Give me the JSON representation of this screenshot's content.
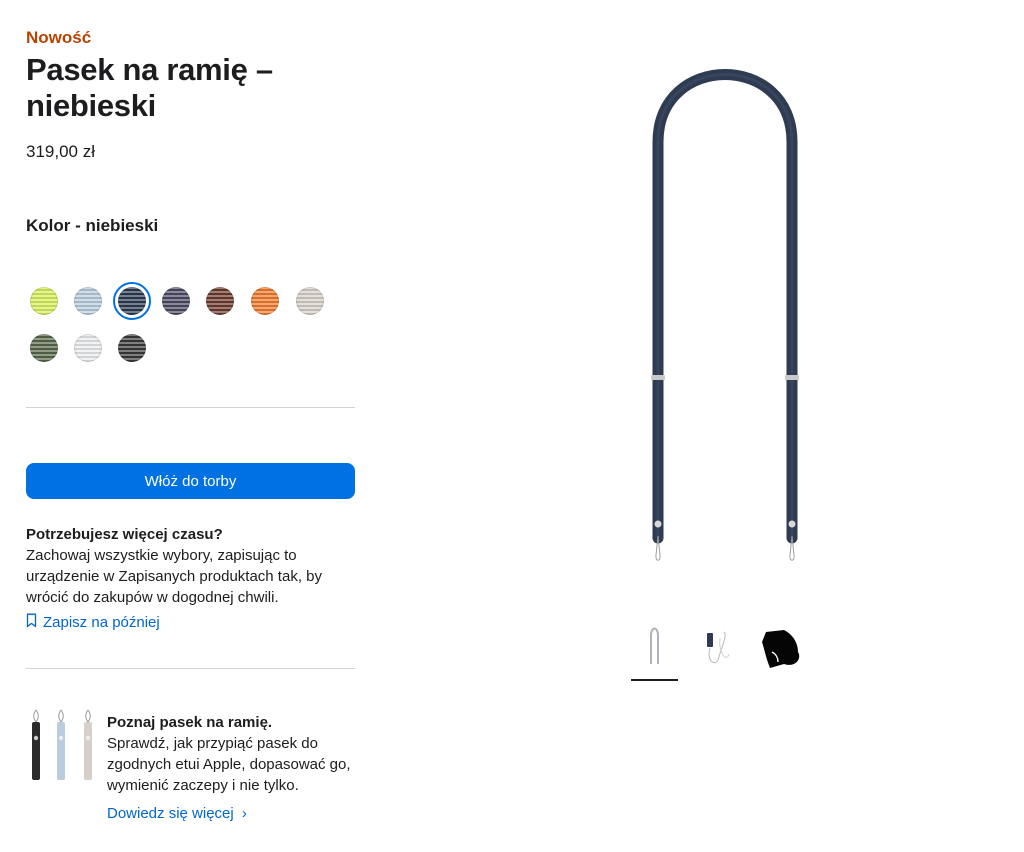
{
  "product": {
    "badge": "Nowość",
    "title": "Pasek na ramię – niebieski",
    "price": "319,00 zł",
    "color_label": "Kolor - niebieski"
  },
  "swatches": [
    {
      "name": "lime",
      "color": "#d8f05a",
      "selected": false
    },
    {
      "name": "light-blue",
      "color": "#b9cddf",
      "selected": false
    },
    {
      "name": "blue",
      "color": "#2c3a52",
      "selected": true
    },
    {
      "name": "purple",
      "color": "#4b4a62",
      "selected": false
    },
    {
      "name": "brown",
      "color": "#6b3b2d",
      "selected": false
    },
    {
      "name": "orange",
      "color": "#f07a2c",
      "selected": false
    },
    {
      "name": "stone",
      "color": "#d7d0c8",
      "selected": false
    },
    {
      "name": "green",
      "color": "#56684a",
      "selected": false
    },
    {
      "name": "white",
      "color": "#e9ebee",
      "selected": false
    },
    {
      "name": "black",
      "color": "#3a3a3c",
      "selected": false
    }
  ],
  "actions": {
    "add_to_bag": "Włóż do torby",
    "save_later": "Zapisz na później"
  },
  "more_time": {
    "heading": "Potrzebujesz więcej czasu?",
    "body": "Zachowaj wszystkie wybory, zapisując to urządzenie w Zapisanych produktach tak, by wrócić do zakupów w dogodnej chwili."
  },
  "promo": {
    "heading": "Poznaj pasek na ramię.",
    "body": "Sprawdź, jak przypiąć pasek do zgodnych etui Apple, dopasować go, wymienić zaczepy i nie tylko.",
    "link": "Dowiedz się więcej",
    "link_chevron": "›"
  },
  "gallery": {
    "accent": "#2e3b51"
  }
}
